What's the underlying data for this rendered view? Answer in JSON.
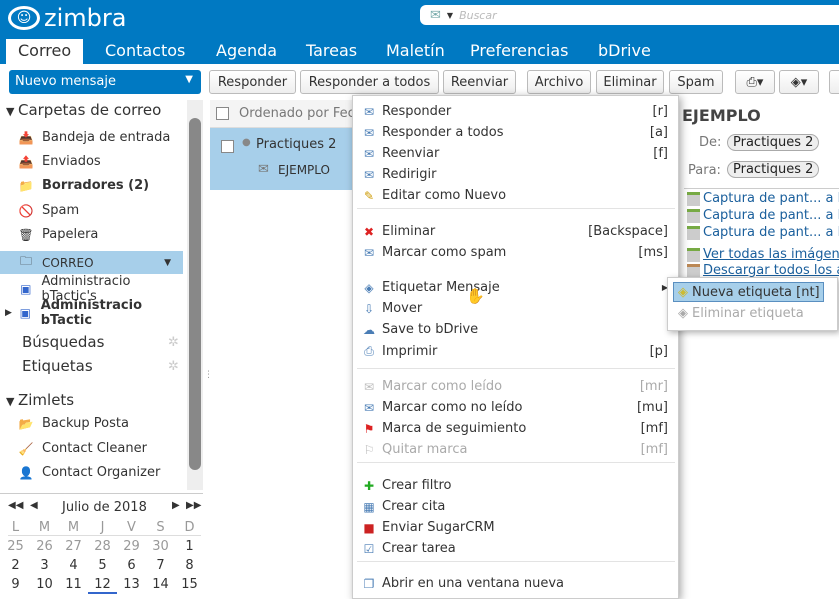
{
  "header": {
    "logo": "zimbra",
    "search_placeholder": "Buscar"
  },
  "tabs": [
    "Correo",
    "Contactos",
    "Agenda",
    "Tareas",
    "Maletín",
    "Preferencias",
    "bDrive"
  ],
  "toolbar": {
    "new_message": "Nuevo mensaje",
    "buttons": [
      "Responder",
      "Responder a todos",
      "Reenviar",
      "Archivo",
      "Eliminar",
      "Spam"
    ]
  },
  "sidebar": {
    "mail_folders_title": "Carpetas de correo",
    "folders": [
      {
        "label": "Bandeja de entrada",
        "icon": "inbox-icon"
      },
      {
        "label": "Enviados",
        "icon": "sent-icon"
      },
      {
        "label": "Borradores (2)",
        "icon": "drafts-icon",
        "bold": true
      },
      {
        "label": "Spam",
        "icon": "spam-icon"
      },
      {
        "label": "Papelera",
        "icon": "trash-icon"
      },
      {
        "label": "CORREO",
        "icon": "folder-icon",
        "selected": true
      },
      {
        "label": "Administracio bTactic's",
        "icon": "shared-folder-icon"
      },
      {
        "label": "Administracio bTactic",
        "icon": "shared-folder-icon",
        "bold": true
      }
    ],
    "searches": "Búsquedas",
    "tags": "Etiquetas",
    "zimlets_title": "Zimlets",
    "zimlets": [
      "Backup Posta",
      "Contact Cleaner",
      "Contact Organizer"
    ]
  },
  "calendar": {
    "month": "Julio de 2018",
    "weekdays": [
      "L",
      "M",
      "M",
      "J",
      "V",
      "S",
      "D"
    ],
    "weeks": [
      [
        "25",
        "26",
        "27",
        "28",
        "29",
        "30",
        "1"
      ],
      [
        "2",
        "3",
        "4",
        "5",
        "6",
        "7",
        "8"
      ],
      [
        "9",
        "10",
        "11",
        "12",
        "13",
        "14",
        "15"
      ]
    ],
    "today": "12"
  },
  "list": {
    "sort": "Ordenado por Fecha",
    "sender": "Practiques 2",
    "subject": "EJEMPLO"
  },
  "context_menu": [
    {
      "label": "Responder",
      "shortcut": "[r]",
      "icon": "reply-icon"
    },
    {
      "label": "Responder a todos",
      "shortcut": "[a]",
      "icon": "reply-all-icon"
    },
    {
      "label": "Reenviar",
      "shortcut": "[f]",
      "icon": "forward-icon"
    },
    {
      "label": "Redirigir",
      "shortcut": "",
      "icon": "redirect-icon"
    },
    {
      "label": "Editar como Nuevo",
      "shortcut": "",
      "icon": "edit-icon"
    },
    {
      "label": "Eliminar",
      "shortcut": "[Backspace]",
      "icon": "delete-icon"
    },
    {
      "label": "Marcar como spam",
      "shortcut": "[ms]",
      "icon": "spam-icon"
    },
    {
      "label": "Etiquetar Mensaje",
      "shortcut": "",
      "icon": "tag-icon",
      "submenu": true
    },
    {
      "label": "Mover",
      "shortcut": "",
      "icon": "move-icon"
    },
    {
      "label": "Save to bDrive",
      "shortcut": "",
      "icon": "bdrive-icon"
    },
    {
      "label": "Imprimir",
      "shortcut": "[p]",
      "icon": "print-icon"
    },
    {
      "label": "Marcar como leído",
      "shortcut": "[mr]",
      "icon": "read-icon",
      "disabled": true
    },
    {
      "label": "Marcar como no leído",
      "shortcut": "[mu]",
      "icon": "unread-icon"
    },
    {
      "label": "Marca de seguimiento",
      "shortcut": "[mf]",
      "icon": "flag-icon"
    },
    {
      "label": "Quitar marca",
      "shortcut": "[mf]",
      "icon": "unflag-icon",
      "disabled": true
    },
    {
      "label": "Crear filtro",
      "shortcut": "",
      "icon": "filter-icon"
    },
    {
      "label": "Crear cita",
      "shortcut": "",
      "icon": "appointment-icon"
    },
    {
      "label": "Enviar SugarCRM",
      "shortcut": "",
      "icon": "sugarcrm-icon"
    },
    {
      "label": "Crear tarea",
      "shortcut": "",
      "icon": "task-icon"
    },
    {
      "label": "Abrir en una ventana nueva",
      "shortcut": "",
      "icon": "new-window-icon"
    }
  ],
  "submenu": [
    {
      "label": "Nueva etiqueta [nt]",
      "selected": true
    },
    {
      "label": "Eliminar etiqueta",
      "disabled": true
    }
  ],
  "reading": {
    "subject": "EJEMPLO",
    "from_label": "De:",
    "from": "Practiques 2",
    "to_label": "Para:",
    "to": "Practiques 2",
    "attachments": [
      "Captura de pant... a la",
      "Captura de pant... a la",
      "Captura de pant... a la"
    ],
    "view_all": "Ver todas las imágenes",
    "download_all": "Descargar todos los a"
  }
}
